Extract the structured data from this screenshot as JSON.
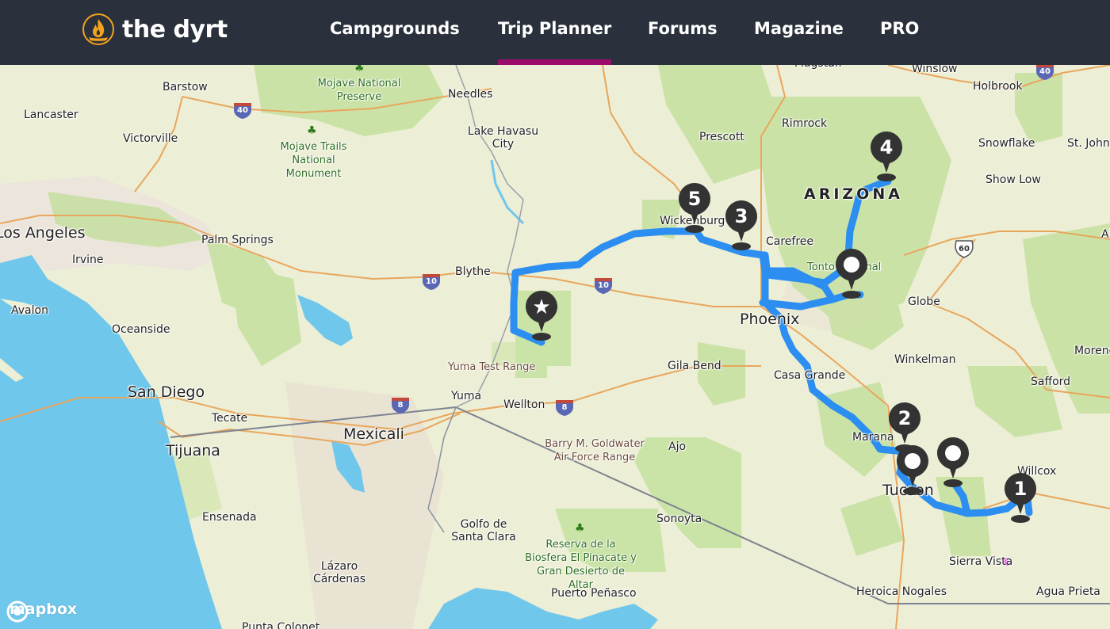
{
  "brand": {
    "name": "the dyrt",
    "accent": "#f4a31c"
  },
  "nav": {
    "items": [
      {
        "label": "Campgrounds",
        "active": false
      },
      {
        "label": "Trip Planner",
        "active": true
      },
      {
        "label": "Forums",
        "active": false
      },
      {
        "label": "Magazine",
        "active": false
      },
      {
        "label": "PRO",
        "active": false
      }
    ],
    "active_color": "#9c0b6b"
  },
  "map": {
    "attribution": "mapbox",
    "state_label": "ARIZONA",
    "route_color": "#2b8ef0",
    "cities": [
      {
        "name": "Barstow"
      },
      {
        "name": "Lancaster"
      },
      {
        "name": "Victorville"
      },
      {
        "name": "Los Angeles"
      },
      {
        "name": "Irvine"
      },
      {
        "name": "Palm Springs"
      },
      {
        "name": "Avalon"
      },
      {
        "name": "Oceanside"
      },
      {
        "name": "San Diego"
      },
      {
        "name": "Tecate"
      },
      {
        "name": "Tijuana"
      },
      {
        "name": "Mexicali"
      },
      {
        "name": "Ensenada"
      },
      {
        "name": "Lázaro Cárdenas"
      },
      {
        "name": "Needles"
      },
      {
        "name": "Lake Havasu City"
      },
      {
        "name": "Blythe"
      },
      {
        "name": "Yuma"
      },
      {
        "name": "Wellton"
      },
      {
        "name": "Golfo de Santa Clara"
      },
      {
        "name": "Puerto Peñasco"
      },
      {
        "name": "Sonoyta"
      },
      {
        "name": "Ajo"
      },
      {
        "name": "Gila Bend"
      },
      {
        "name": "Prescott"
      },
      {
        "name": "Wickenburg"
      },
      {
        "name": "Carefree"
      },
      {
        "name": "Phoenix"
      },
      {
        "name": "Casa Grande"
      },
      {
        "name": "Marana"
      },
      {
        "name": "Tucson"
      },
      {
        "name": "Flagstaff"
      },
      {
        "name": "Rimrock"
      },
      {
        "name": "Winslow"
      },
      {
        "name": "Holbrook"
      },
      {
        "name": "Snowflake"
      },
      {
        "name": "St. Johns"
      },
      {
        "name": "Show Low"
      },
      {
        "name": "Globe"
      },
      {
        "name": "Winkelman"
      },
      {
        "name": "Safford"
      },
      {
        "name": "Morenci"
      },
      {
        "name": "Willcox"
      },
      {
        "name": "Sierra Vista"
      },
      {
        "name": "Heroica Nogales"
      },
      {
        "name": "Agua Prieta"
      },
      {
        "name": "Punta Colonet"
      },
      {
        "name": "Alpine"
      }
    ],
    "parks": [
      {
        "name": "Mojave National Preserve"
      },
      {
        "name": "Mojave Trails National Monument"
      },
      {
        "name": "Reserva de la Biosfera El Pinacate y Gran Desierto de Altar"
      },
      {
        "name": "Tonto National Forest"
      }
    ],
    "military": [
      {
        "name": "Yuma Test Range"
      },
      {
        "name": "Barry M. Goldwater Air Force Range"
      }
    ],
    "highways": [
      {
        "type": "interstate",
        "number": "40"
      },
      {
        "type": "interstate",
        "number": "40"
      },
      {
        "type": "interstate",
        "number": "10"
      },
      {
        "type": "interstate",
        "number": "10"
      },
      {
        "type": "interstate",
        "number": "8"
      },
      {
        "type": "interstate",
        "number": "8"
      },
      {
        "type": "us",
        "number": "60"
      }
    ],
    "markers": [
      {
        "label": "★",
        "kind": "start"
      },
      {
        "label": "1",
        "kind": "numbered"
      },
      {
        "label": "2",
        "kind": "numbered"
      },
      {
        "label": "3",
        "kind": "numbered"
      },
      {
        "label": "4",
        "kind": "numbered"
      },
      {
        "label": "5",
        "kind": "numbered"
      },
      {
        "label": "",
        "kind": "dot"
      },
      {
        "label": "",
        "kind": "dot"
      },
      {
        "label": "",
        "kind": "dot"
      }
    ]
  }
}
